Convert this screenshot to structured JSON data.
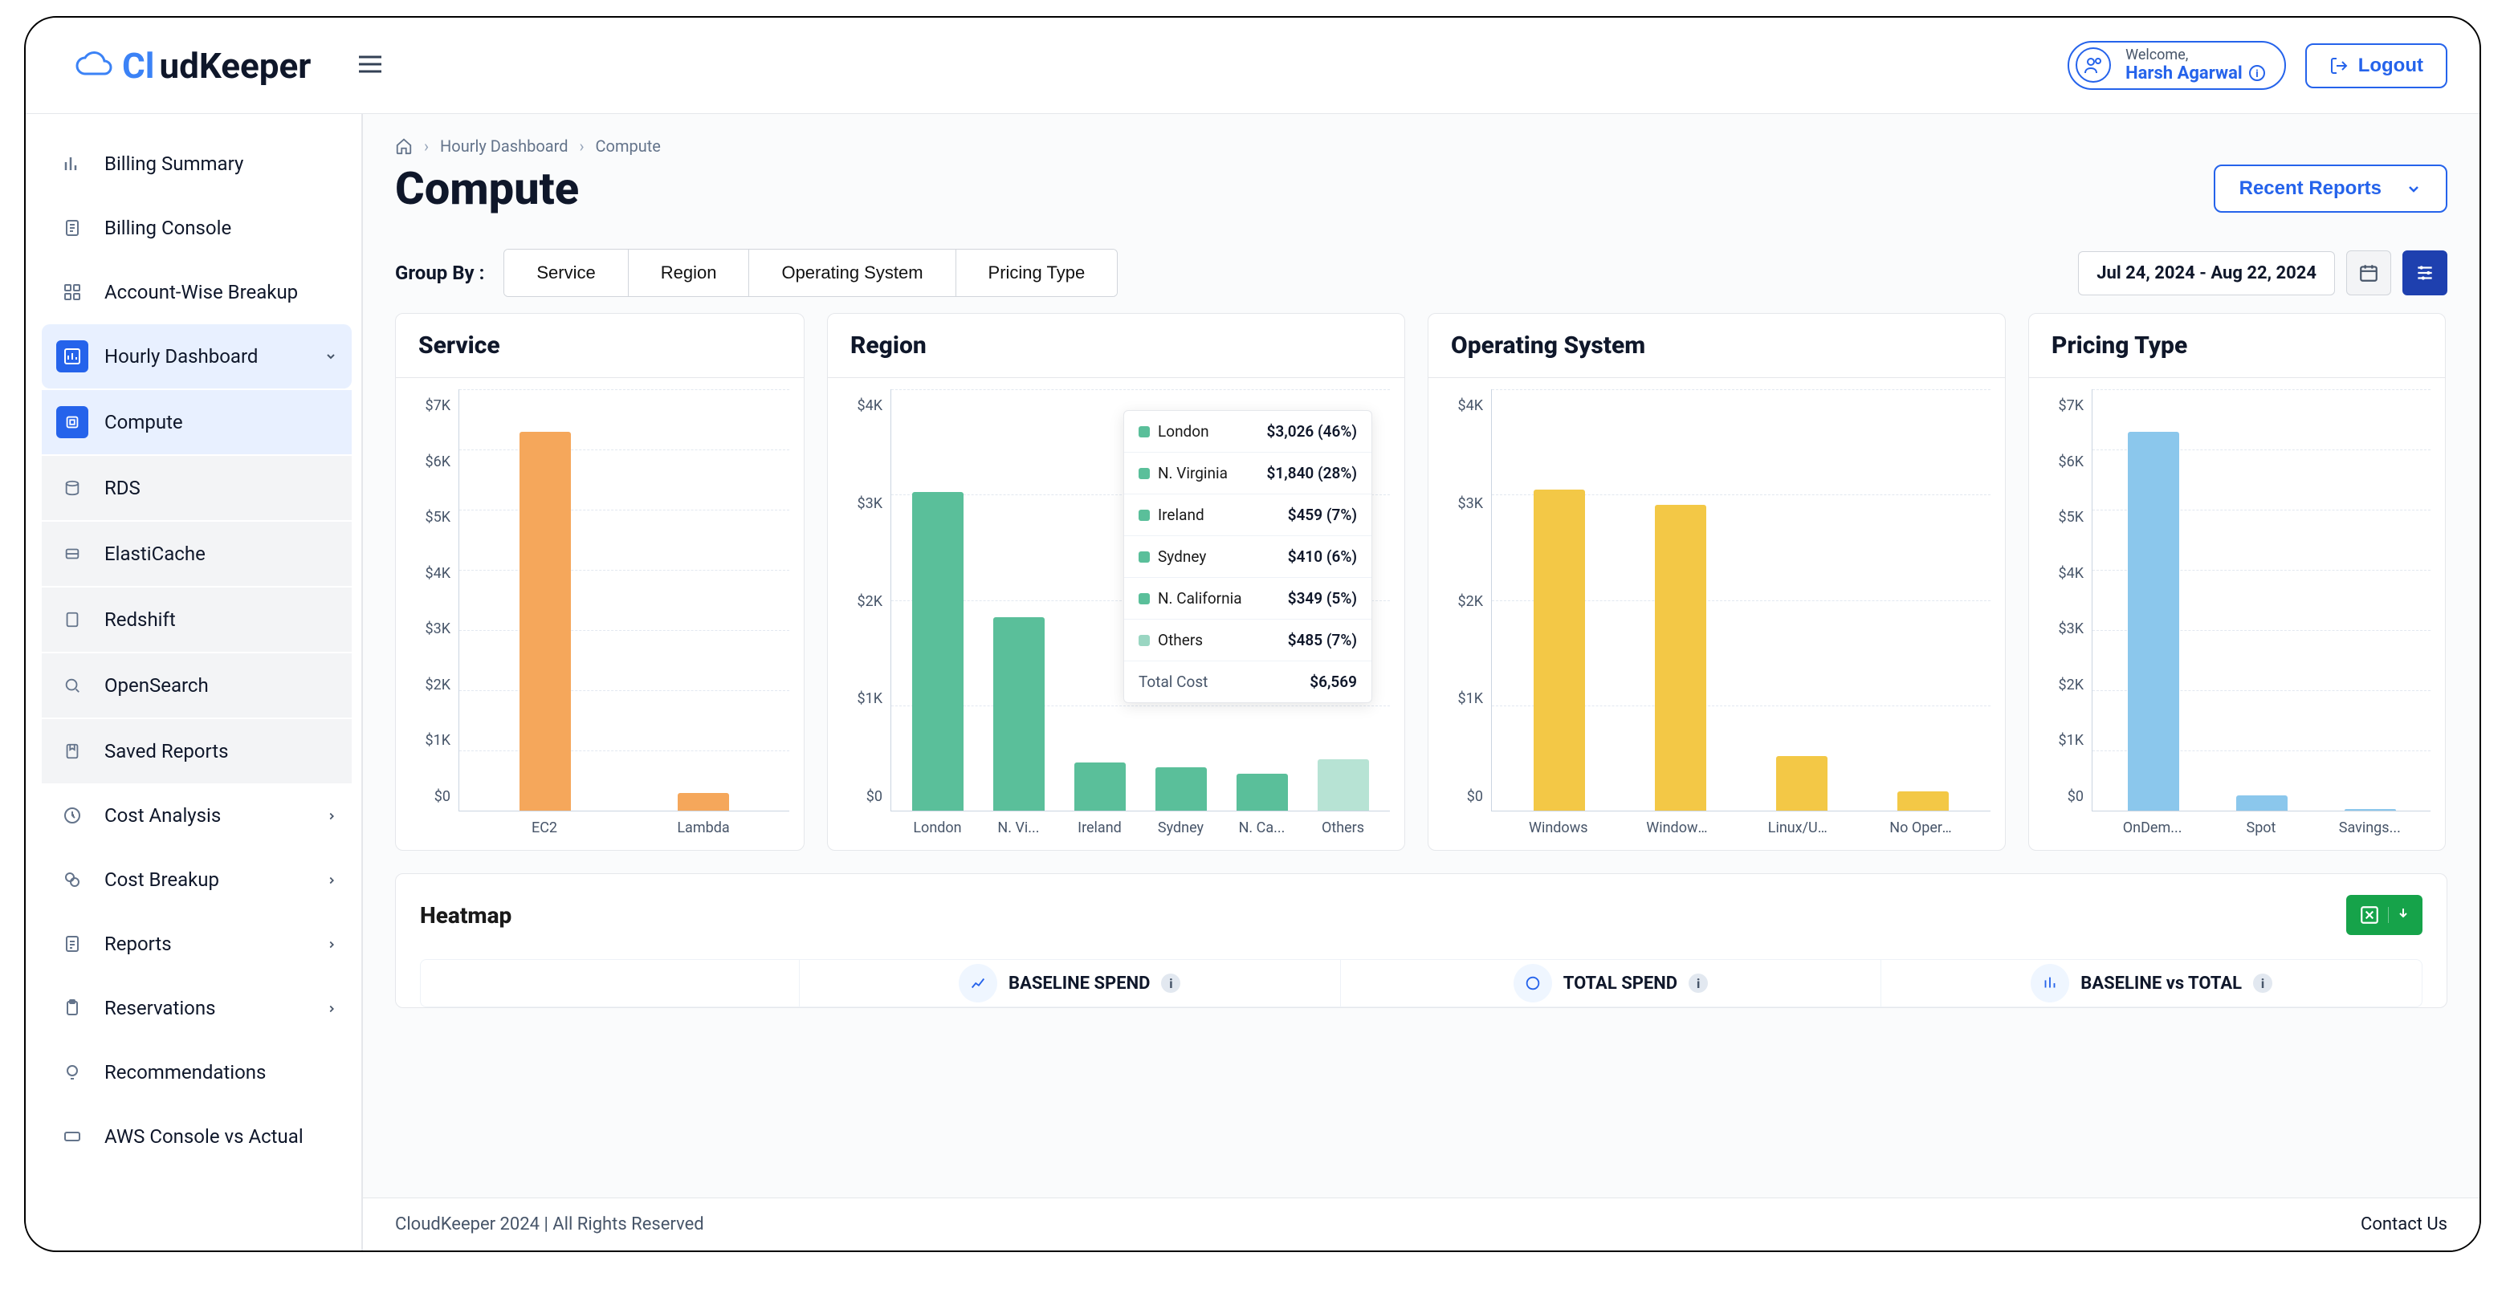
{
  "header": {
    "logo_cloud": "Cl",
    "logo_rest": "udKeeper",
    "welcome": "Welcome,",
    "username": "Harsh Agarwal",
    "logout": "Logout"
  },
  "sidebar": {
    "items": [
      {
        "label": "Billing Summary"
      },
      {
        "label": "Billing Console"
      },
      {
        "label": "Account-Wise Breakup"
      },
      {
        "label": "Hourly Dashboard"
      },
      {
        "label": "Compute"
      },
      {
        "label": "RDS"
      },
      {
        "label": "ElastiCache"
      },
      {
        "label": "Redshift"
      },
      {
        "label": "OpenSearch"
      },
      {
        "label": "Saved Reports"
      },
      {
        "label": "Cost Analysis"
      },
      {
        "label": "Cost Breakup"
      },
      {
        "label": "Reports"
      },
      {
        "label": "Reservations"
      },
      {
        "label": "Recommendations"
      },
      {
        "label": "AWS Console vs Actual"
      }
    ]
  },
  "breadcrumbs": {
    "b1": "Hourly Dashboard",
    "b2": "Compute"
  },
  "page": {
    "title": "Compute",
    "recent_reports": "Recent Reports"
  },
  "controls": {
    "group_by_label": "Group By :",
    "group_by": [
      "Service",
      "Region",
      "Operating System",
      "Pricing Type"
    ],
    "date_range": "Jul 24, 2024 - Aug 22, 2024"
  },
  "chart_data": [
    {
      "title": "Service",
      "type": "bar",
      "ylim": [
        0,
        7000
      ],
      "ticks": [
        "$7K",
        "$6K",
        "$5K",
        "$4K",
        "$3K",
        "$2K",
        "$1K",
        "$0"
      ],
      "categories": [
        "EC2",
        "Lambda"
      ],
      "values": [
        6300,
        300
      ],
      "color": "#f5a75b"
    },
    {
      "title": "Region",
      "type": "bar",
      "ylim": [
        0,
        4000
      ],
      "ticks": [
        "$4K",
        "$3K",
        "$2K",
        "$1K",
        "$0"
      ],
      "categories": [
        "London",
        "N. Vi...",
        "Ireland",
        "Sydney",
        "N. Ca...",
        "Others"
      ],
      "values": [
        3026,
        1840,
        459,
        410,
        349,
        485
      ],
      "color": "#5abf9a",
      "tooltip": {
        "rows": [
          {
            "name": "London",
            "value": "$3,026 (46%)",
            "color": "#5abf9a"
          },
          {
            "name": "N. Virginia",
            "value": "$1,840 (28%)",
            "color": "#5abf9a"
          },
          {
            "name": "Ireland",
            "value": "$459 (7%)",
            "color": "#5abf9a"
          },
          {
            "name": "Sydney",
            "value": "$410 (6%)",
            "color": "#5abf9a"
          },
          {
            "name": "N. California",
            "value": "$349 (5%)",
            "color": "#5abf9a"
          },
          {
            "name": "Others",
            "value": "$485 (7%)",
            "color": "#9ad6c2"
          }
        ],
        "total_label": "Total Cost",
        "total_value": "$6,569"
      }
    },
    {
      "title": "Operating System",
      "type": "bar",
      "ylim": [
        0,
        4000
      ],
      "ticks": [
        "$4K",
        "$3K",
        "$2K",
        "$1K",
        "$0"
      ],
      "categories": [
        "Windows",
        "Windows...",
        "Linux/UN...",
        "No Operat..."
      ],
      "values": [
        3050,
        2900,
        520,
        180
      ],
      "color": "#f3c846"
    },
    {
      "title": "Pricing Type",
      "type": "bar",
      "ylim": [
        0,
        7000
      ],
      "ticks": [
        "$7K",
        "$6K",
        "$5K",
        "$4K",
        "$3K",
        "$2K",
        "$1K",
        "$0"
      ],
      "categories": [
        "OnDem...",
        "Spot",
        "Savings..."
      ],
      "values": [
        6300,
        250,
        30
      ],
      "color": "#8bc7ec"
    }
  ],
  "heatmap": {
    "title": "Heatmap",
    "stats": [
      "BASELINE SPEND",
      "TOTAL SPEND",
      "BASELINE vs TOTAL"
    ]
  },
  "footer": {
    "copyright": "CloudKeeper 2024 | All Rights Reserved",
    "contact": "Contact Us"
  }
}
